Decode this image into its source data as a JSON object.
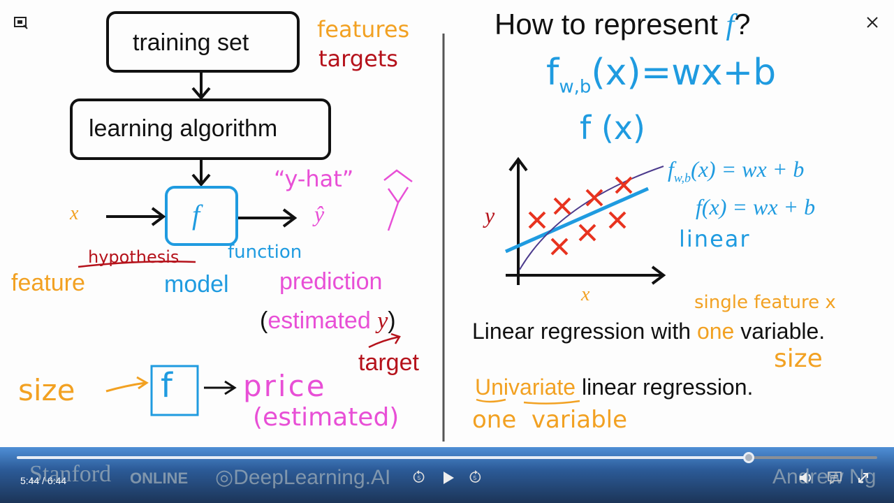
{
  "slide": {
    "left": {
      "training_set": "training set",
      "learning_algorithm": "learning algorithm",
      "features": "features",
      "targets": "targets",
      "x": "x",
      "f": "f",
      "y_hat_quote": "“y-hat”",
      "y_hat": "ŷ",
      "y_hat_drawn": "ŷ",
      "hypothesis": "hypothesis",
      "function": "function",
      "feature": "feature",
      "model": "model",
      "prediction": "prediction",
      "estimated_open": "(",
      "estimated": "estimated",
      "estimated_y": "y",
      "estimated_close": ")",
      "target": "target",
      "size": "size",
      "f_box": "f",
      "price": "price",
      "price_estimated": "(estimated)"
    },
    "right": {
      "title_prefix": "How to represent ",
      "title_f": "f",
      "title_suffix": "?",
      "eq1": "f_w,b(x)=wx+b",
      "eq1_f": "f",
      "eq1_sub": "w,b",
      "eq1_rest": "(x)=wx+b",
      "eq2": "f (x)",
      "graph_y": "y",
      "graph_x": "x",
      "legend_eq1_f": "f",
      "legend_eq1_sub": "w,b",
      "legend_eq1_rest": "(x) = wx + b",
      "legend_eq2": "f(x) = wx + b",
      "linear": "linear",
      "single_feature": "single feature x",
      "lr_prefix": "Linear regression with ",
      "lr_one": "one",
      "lr_suffix": " variable.",
      "size": "size",
      "univariate": "Univariate",
      "uni_suffix": " linear regression.",
      "one_variable": "one  variable"
    }
  },
  "player": {
    "current_time": "5:44",
    "duration": "6:44",
    "time_display": "5:44 / 6:44",
    "progress": 0.851,
    "watermark_stanford": "Stanford",
    "watermark_online": "ONLINE",
    "watermark_dlai": "DeepLearning.AI",
    "watermark_author": "Andrew Ng",
    "rewind_seconds": "5",
    "forward_seconds": "5",
    "icons": [
      "picture-in-picture-icon",
      "close-icon",
      "rewind-5-icon",
      "play-icon",
      "forward-5-icon",
      "volume-icon",
      "captions-icon",
      "fullscreen-icon"
    ]
  },
  "colors": {
    "orange": "#f2a122",
    "red": "#b5121b",
    "blue": "#1f9be0",
    "pink": "#e84fd6",
    "bar": "#2c5b98"
  }
}
